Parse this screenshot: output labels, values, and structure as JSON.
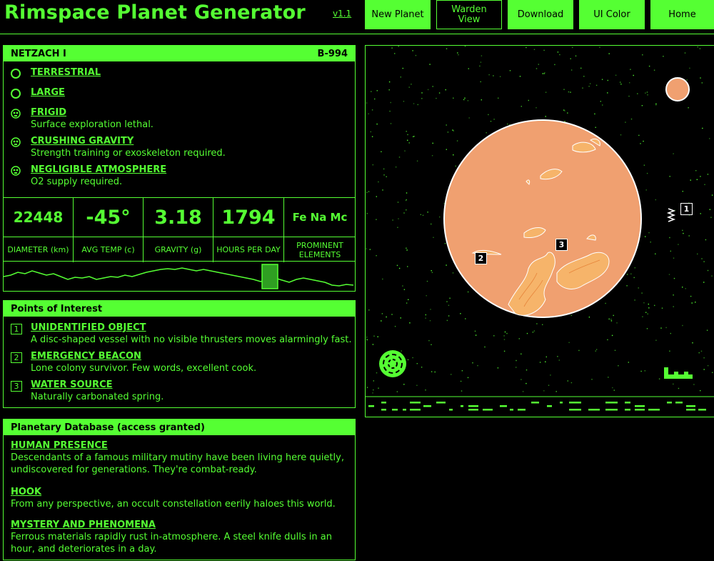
{
  "app": {
    "title": "Rimspace Planet Generator",
    "version": "v1.1"
  },
  "nav": [
    {
      "label": "New Planet",
      "style": "filled"
    },
    {
      "label": "Warden View",
      "style": "outline"
    },
    {
      "label": "Download",
      "style": "filled"
    },
    {
      "label": "UI Color",
      "style": "filled"
    },
    {
      "label": "Home",
      "style": "filled"
    }
  ],
  "planet": {
    "name": "NETZACH I",
    "code": "B-994",
    "traits": [
      {
        "icon": "circle-icon",
        "name": "TERRESTRIAL",
        "desc": ""
      },
      {
        "icon": "circle-icon",
        "name": "LARGE",
        "desc": ""
      },
      {
        "icon": "skull-icon",
        "name": "FRIGID",
        "desc": "Surface exploration lethal."
      },
      {
        "icon": "skull-icon",
        "name": "CRUSHING GRAVITY",
        "desc": "Strength training or exoskeleton required."
      },
      {
        "icon": "skull-icon",
        "name": "NEGLIGIBLE ATMOSPHERE",
        "desc": "O2 supply required."
      }
    ],
    "stats": [
      {
        "value": "22448",
        "label": "DIAMETER (km)"
      },
      {
        "value": "-45°",
        "label": "AVG TEMP (c)"
      },
      {
        "value": "3.18",
        "label": "GRAVITY (g)"
      },
      {
        "value": "1794",
        "label": "HOURS PER DAY"
      },
      {
        "value": "Fe Na Mc",
        "label": "PROMINENT ELEMENTS"
      }
    ]
  },
  "poi": {
    "title": "Points of Interest",
    "items": [
      {
        "num": "1",
        "name": "UNIDENTIFIED OBJECT",
        "desc": "A disc-shaped vessel with no visible thrusters moves alarmingly fast."
      },
      {
        "num": "2",
        "name": "EMERGENCY BEACON",
        "desc": "Lone colony survivor. Few words, excellent cook."
      },
      {
        "num": "3",
        "name": "WATER SOURCE",
        "desc": "Naturally carbonated spring."
      }
    ]
  },
  "database": {
    "title": "Planetary Database (access granted)",
    "items": [
      {
        "name": "HUMAN PRESENCE",
        "desc": "Descendants of a famous military mutiny have been living here quietly, undiscovered for generations. They're combat-ready."
      },
      {
        "name": "HOOK",
        "desc": "From any perspective, an occult constellation eerily haloes this world."
      },
      {
        "name": "MYSTERY AND PHENOMENA",
        "desc": "Ferrous materials rapidly rust in-atmosphere. A steel knife dulls in an hour, and deteriorates in a day."
      }
    ]
  },
  "map": {
    "markers": [
      "1",
      "2",
      "3"
    ],
    "planet_color": "#f0a070",
    "accent": "#55ff33"
  }
}
